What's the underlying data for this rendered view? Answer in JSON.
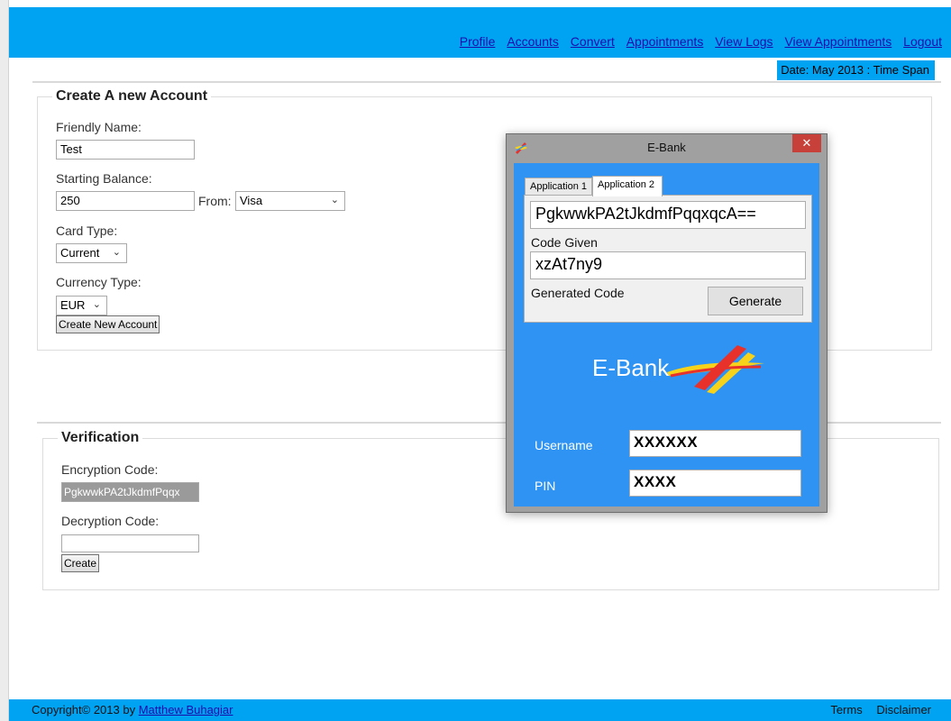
{
  "nav": {
    "items": [
      "Profile",
      "Accounts",
      "Convert",
      "Appointments",
      "View Logs",
      "View Appointments",
      "Logout"
    ]
  },
  "date_bar": {
    "text": "Date: May 2013 : Time Span"
  },
  "create_account": {
    "legend": "Create A new Account",
    "friendly_name_label": "Friendly Name:",
    "friendly_name_value": "Test",
    "starting_balance_label": "Starting Balance:",
    "starting_balance_value": "250",
    "from_label": "From:",
    "from_value": "Visa",
    "card_type_label": "Card Type:",
    "card_type_value": "Current",
    "currency_type_label": "Currency Type:",
    "currency_type_value": "EUR",
    "submit_label": "Create New Account"
  },
  "verification": {
    "legend": "Verification",
    "encryption_label": "Encryption Code:",
    "encryption_value": "PgkwwkPA2tJkdmfPqqx",
    "decryption_label": "Decryption Code:",
    "decryption_value": "",
    "submit_label": "Create"
  },
  "ebank_window": {
    "title": "E-Bank",
    "close_glyph": "✕",
    "tabs": [
      {
        "label": "Application 1",
        "active": false
      },
      {
        "label": "Application 2",
        "active": true
      }
    ],
    "code_value": "PgkwwkPA2tJkdmfPqqxqcA==",
    "code_given_label": "Code Given",
    "generated_value": "xzAt7ny9",
    "generated_code_label": "Generated Code",
    "generate_button_label": "Generate",
    "logo_text": "E-Bank",
    "username_label": "Username",
    "username_value": "XXXXXX",
    "pin_label": "PIN",
    "pin_value": "XXXX"
  },
  "footer": {
    "copyright_prefix": "Copyright© 2013 by ",
    "author_link": "Matthew Buhagiar",
    "links": [
      "Terms",
      "Disclaimer"
    ]
  },
  "colors": {
    "header_blue": "#00a2f2",
    "window_blue": "#2e93f2",
    "link": "#1a0dab",
    "close_red": "#c7403a"
  }
}
